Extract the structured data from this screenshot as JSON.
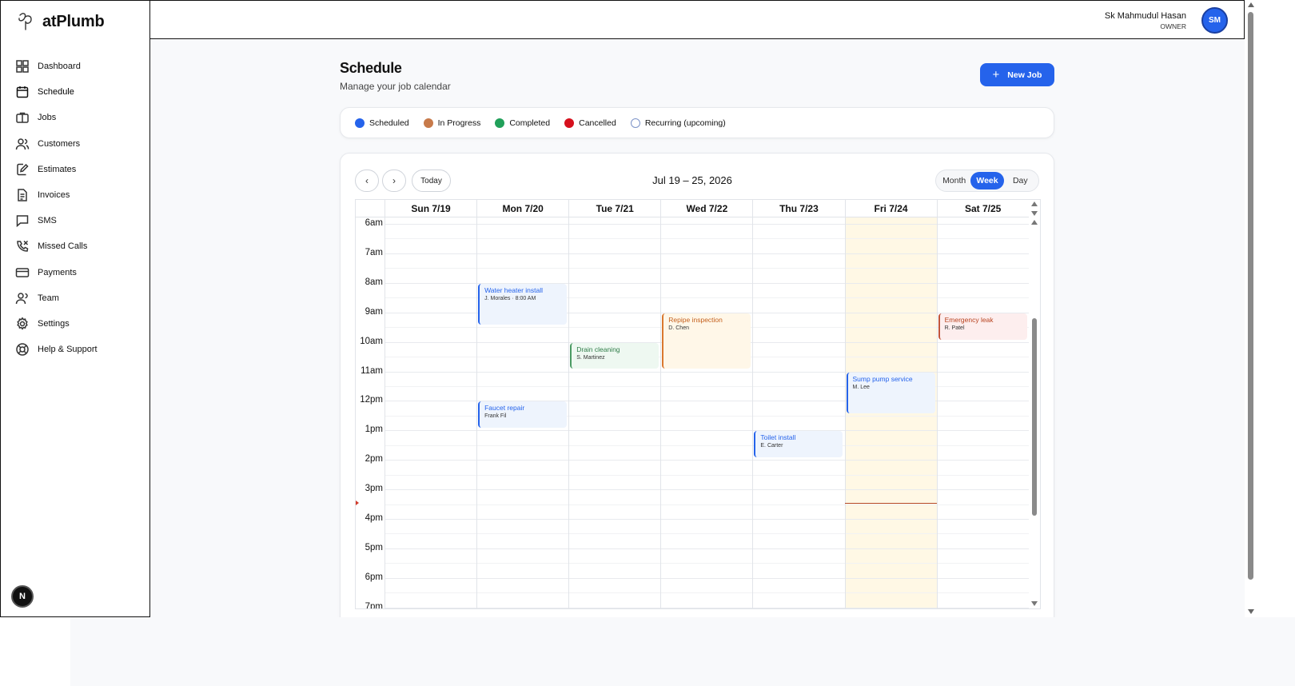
{
  "brand": {
    "name": "atPlumb"
  },
  "sidebar": {
    "items": [
      {
        "label": "Dashboard",
        "icon": "dashboard-icon"
      },
      {
        "label": "Schedule",
        "icon": "calendar-icon"
      },
      {
        "label": "Jobs",
        "icon": "briefcase-icon"
      },
      {
        "label": "Customers",
        "icon": "users-icon"
      },
      {
        "label": "Estimates",
        "icon": "edit-document-icon"
      },
      {
        "label": "Invoices",
        "icon": "document-icon"
      },
      {
        "label": "SMS",
        "icon": "message-icon"
      },
      {
        "label": "Missed Calls",
        "icon": "missed-call-icon"
      },
      {
        "label": "Payments",
        "icon": "credit-card-icon"
      },
      {
        "label": "Team",
        "icon": "team-icon"
      },
      {
        "label": "Settings",
        "icon": "gear-icon"
      },
      {
        "label": "Help & Support",
        "icon": "lifebuoy-icon"
      }
    ],
    "active": "Schedule",
    "badge": "N"
  },
  "topbar": {
    "user_name": "Sk Mahmudul Hasan",
    "user_role": "OWNER",
    "avatar_initials": "SM"
  },
  "page": {
    "title": "Schedule",
    "subtitle": "Manage your job calendar",
    "new_job_label": "New Job"
  },
  "legend": [
    {
      "label": "Scheduled",
      "color": "#2563eb",
      "style": "filled"
    },
    {
      "label": "In Progress",
      "color": "#c77a4a",
      "style": "filled"
    },
    {
      "label": "Completed",
      "color": "#21a05a",
      "style": "filled"
    },
    {
      "label": "Cancelled",
      "color": "#d6101d",
      "style": "filled"
    },
    {
      "label": "Recurring (upcoming)",
      "color": "#7c93c8",
      "style": "outline"
    }
  ],
  "calendar": {
    "prev_label": "‹",
    "next_label": "›",
    "today_label": "Today",
    "range": "Jul 19 – 25, 2026",
    "views": [
      "Month",
      "Week",
      "Day"
    ],
    "active_view": "Week",
    "days": [
      "Sun 7/19",
      "Mon 7/20",
      "Tue 7/21",
      "Wed 7/22",
      "Thu 7/23",
      "Fri 7/24",
      "Sat 7/25"
    ],
    "today_index": 5,
    "hours": [
      "6am",
      "7am",
      "8am",
      "9am",
      "10am",
      "11am",
      "12pm",
      "1pm",
      "2pm",
      "3pm",
      "4pm",
      "5pm",
      "6pm",
      "7pm"
    ],
    "now_hour": 15.45,
    "events": [
      {
        "title": "Water heater install",
        "sub": "J. Morales · 8:00 AM",
        "day": 1,
        "start": 8.0,
        "end": 9.5,
        "color": "blue"
      },
      {
        "title": "Repipe inspection",
        "sub": "D. Chen",
        "day": 3,
        "start": 9.0,
        "end": 11.0,
        "color": "orange"
      },
      {
        "title": "Emergency leak",
        "sub": "R. Patel",
        "day": 6,
        "start": 9.0,
        "end": 10.0,
        "color": "red"
      },
      {
        "title": "Drain cleaning",
        "sub": "S. Martinez",
        "day": 2,
        "start": 10.0,
        "end": 11.0,
        "color": "green"
      },
      {
        "title": "Sump pump service",
        "sub": "M. Lee",
        "day": 5,
        "start": 11.0,
        "end": 12.5,
        "color": "blue"
      },
      {
        "title": "Faucet repair",
        "sub": "Frank Fil",
        "day": 1,
        "start": 12.0,
        "end": 13.0,
        "color": "blue"
      },
      {
        "title": "Toilet install",
        "sub": "E. Carter",
        "day": 4,
        "start": 13.0,
        "end": 14.0,
        "color": "blue"
      }
    ]
  }
}
